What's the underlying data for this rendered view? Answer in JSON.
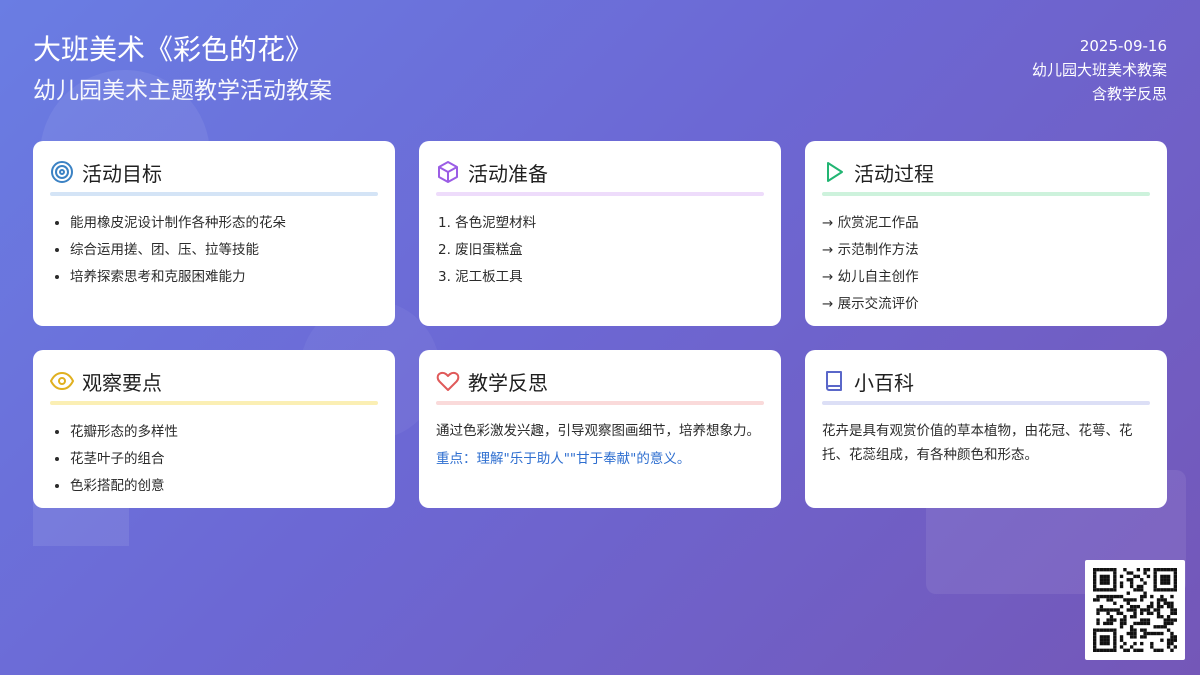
{
  "header": {
    "title": "大班美术《彩色的花》",
    "subtitle": "幼儿园美术主题教学活动教案",
    "date": "2025-09-16",
    "meta_1": "幼儿园大班美术教案",
    "meta_2": "含教学反思"
  },
  "cards": {
    "goals": {
      "title": "活动目标",
      "icon": "target-icon",
      "accent": "#3b82c4",
      "items": [
        "能用橡皮泥设计制作各种形态的花朵",
        "综合运用搓、团、压、拉等技能",
        "培养探索思考和克服困难能力"
      ]
    },
    "preparation": {
      "title": "活动准备",
      "icon": "box-icon",
      "accent": "#9b5de5",
      "items": [
        "1. 各色泥塑材料",
        "2. 废旧蛋糕盒",
        "3. 泥工板工具"
      ]
    },
    "process": {
      "title": "活动过程",
      "icon": "play-icon",
      "accent": "#22b573",
      "items": [
        "→ 欣赏泥工作品",
        "→ 示范制作方法",
        "→ 幼儿自主创作",
        "→ 展示交流评价"
      ]
    },
    "observation": {
      "title": "观察要点",
      "icon": "eye-icon",
      "accent": "#e0b020",
      "items": [
        "花瓣形态的多样性",
        "花茎叶子的组合",
        "色彩搭配的创意"
      ]
    },
    "reflection": {
      "title": "教学反思",
      "icon": "heart-icon",
      "accent": "#e05a5a",
      "text": "通过色彩激发兴趣，引导观察图画细节，培养想象力。",
      "highlight": "重点：理解\"乐于助人\"\"甘于奉献\"的意义。",
      "highlight_color": "#2f6fd0"
    },
    "encyclopedia": {
      "title": "小百科",
      "icon": "book-icon",
      "accent": "#5a67c9",
      "text": "花卉是具有观赏价值的草本植物，由花冠、花萼、花托、花蕊组成，有各种颜色和形态。"
    }
  },
  "qr": {
    "icon": "qr-code-icon"
  }
}
